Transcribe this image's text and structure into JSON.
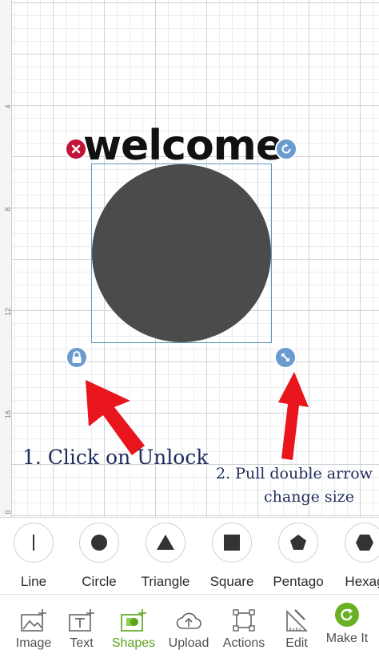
{
  "ruler": {
    "ticks": [
      "4",
      "8",
      "12",
      "16",
      "0"
    ]
  },
  "canvas": {
    "text_object": "welcome",
    "annotation_1": "1. Click on Unlock",
    "annotation_2_line1": "2.  Pull double arrow",
    "annotation_2_line2": "change size"
  },
  "shapes_panel": {
    "items": [
      {
        "label": "Line",
        "icon": "line-icon"
      },
      {
        "label": "Circle",
        "icon": "circle-icon"
      },
      {
        "label": "Triangle",
        "icon": "triangle-icon"
      },
      {
        "label": "Square",
        "icon": "square-icon"
      },
      {
        "label": "Pentago",
        "icon": "pentagon-icon"
      },
      {
        "label": "Hexag",
        "icon": "hexagon-icon"
      }
    ]
  },
  "toolbar": {
    "items": [
      {
        "label": "Image",
        "icon": "image-add-icon"
      },
      {
        "label": "Text",
        "icon": "text-add-icon"
      },
      {
        "label": "Shapes",
        "icon": "shapes-add-icon",
        "active": true
      },
      {
        "label": "Upload",
        "icon": "upload-cloud-icon"
      },
      {
        "label": "Actions",
        "icon": "actions-icon"
      },
      {
        "label": "Edit",
        "icon": "edit-ruler-icon"
      }
    ],
    "make_it": "Make It"
  },
  "colors": {
    "accent": "#6ab023",
    "handle_blue": "#6a9bcf",
    "delete_red": "#c2153a",
    "annotation_arrow": "#e8151d",
    "annotation_text": "#1f2d5c"
  }
}
